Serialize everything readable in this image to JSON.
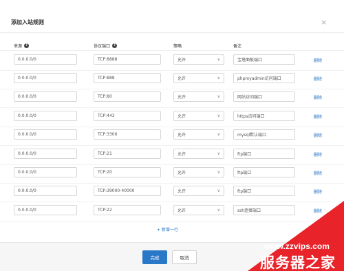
{
  "dialog": {
    "title": "添加入站规则",
    "close_glyph": "×"
  },
  "columns": {
    "source": "来源",
    "port": "协议端口",
    "policy": "策略",
    "note": "备注",
    "help_glyph": "?"
  },
  "rows": [
    {
      "source": "0.0.0.0/0",
      "port": "TCP:8888",
      "policy": "允许",
      "note": "宝塔面板端口",
      "delete": "删除"
    },
    {
      "source": "0.0.0.0/0",
      "port": "TCP:888",
      "policy": "允许",
      "note": "phpmyadmin访问端口",
      "delete": "删除"
    },
    {
      "source": "0.0.0.0/0",
      "port": "TCP:80",
      "policy": "允许",
      "note": "网站访问端口",
      "delete": "删除"
    },
    {
      "source": "0.0.0.0/0",
      "port": "TCP:443",
      "policy": "允许",
      "note": "https访问端口",
      "delete": "删除"
    },
    {
      "source": "0.0.0.0/0",
      "port": "TCP:3306",
      "policy": "允许",
      "note": "mysql默认端口",
      "delete": "删除"
    },
    {
      "source": "0.0.0.0/0",
      "port": "TCP:21",
      "policy": "允许",
      "note": "ftp端口",
      "delete": "删除"
    },
    {
      "source": "0.0.0.0/0",
      "port": "TCP:20",
      "policy": "允许",
      "note": "ftp端口",
      "delete": "删除"
    },
    {
      "source": "0.0.0.0/0",
      "port": "TCP:39000-40000",
      "policy": "允许",
      "note": "ftp端口",
      "delete": "删除"
    },
    {
      "source": "0.0.0.0/0",
      "port": "TCP:22",
      "policy": "允许",
      "note": "ssh连接端口",
      "delete": "删除"
    }
  ],
  "add_row_label": "+ 新增一行",
  "footer": {
    "ok_label": "完成",
    "cancel_label": "取消"
  },
  "watermark": {
    "url": "www.zzvips.com",
    "name": "服务器之家",
    "color": "#e8232a"
  },
  "colors": {
    "primary": "#2a78c8",
    "link": "#1f6fc5"
  }
}
